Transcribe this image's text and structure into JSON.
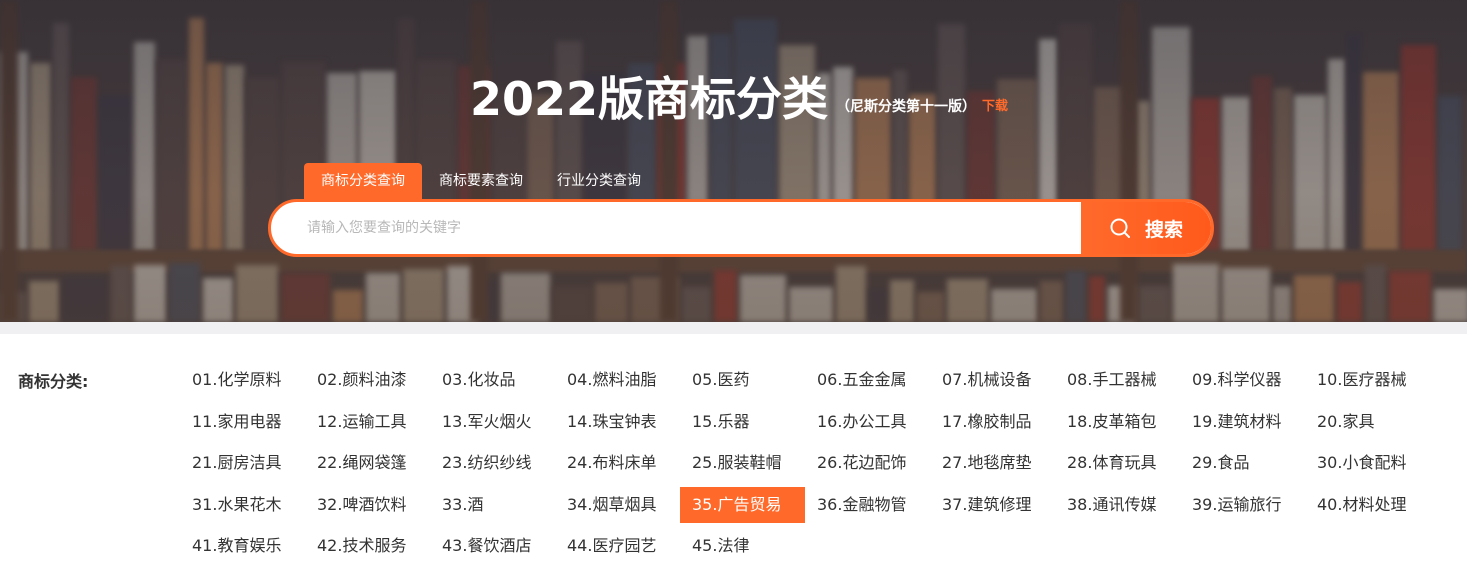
{
  "header": {
    "title": "2022版商标分类",
    "subtitle": "（尼斯分类第十一版）",
    "download_label": "下载"
  },
  "tabs": [
    {
      "label": "商标分类查询",
      "active": true
    },
    {
      "label": "商标要素查询",
      "active": false
    },
    {
      "label": "行业分类查询",
      "active": false
    }
  ],
  "search": {
    "placeholder": "请输入您要查询的关键字",
    "value": "",
    "button_label": "搜索",
    "button_icon": "search-icon"
  },
  "categories": {
    "label": "商标分类:",
    "selected": "35.广告贸易",
    "items": [
      "01.化学原料",
      "02.颜料油漆",
      "03.化妆品",
      "04.燃料油脂",
      "05.医药",
      "06.五金金属",
      "07.机械设备",
      "08.手工器械",
      "09.科学仪器",
      "10.医疗器械",
      "11.家用电器",
      "12.运输工具",
      "13.军火烟火",
      "14.珠宝钟表",
      "15.乐器",
      "16.办公工具",
      "17.橡胶制品",
      "18.皮革箱包",
      "19.建筑材料",
      "20.家具",
      "21.厨房洁具",
      "22.绳网袋篷",
      "23.纺织纱线",
      "24.布料床单",
      "25.服装鞋帽",
      "26.花边配饰",
      "27.地毯席垫",
      "28.体育玩具",
      "29.食品",
      "30.小食配料",
      "31.水果花木",
      "32.啤酒饮料",
      "33.酒",
      "34.烟草烟具",
      "35.广告贸易",
      "36.金融物管",
      "37.建筑修理",
      "38.通讯传媒",
      "39.运输旅行",
      "40.材料处理",
      "41.教育娱乐",
      "42.技术服务",
      "43.餐饮酒店",
      "44.医疗园艺",
      "45.法律"
    ]
  },
  "colors": {
    "accent": "#ff6a2b",
    "text": "#333333",
    "band": "#f0f0f2"
  }
}
